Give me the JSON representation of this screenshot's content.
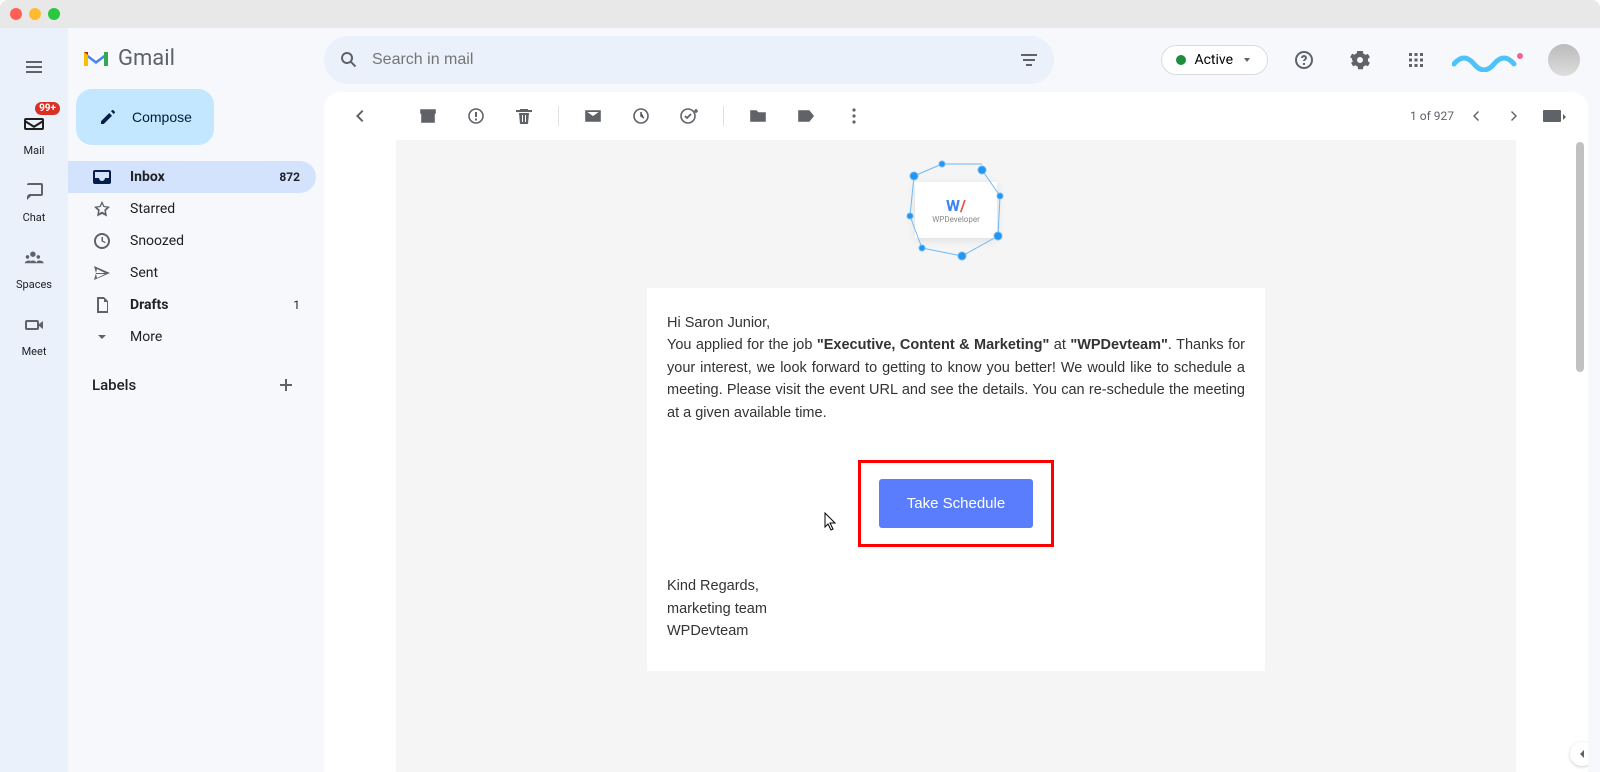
{
  "brand": {
    "name": "Gmail"
  },
  "rail": {
    "mail": {
      "label": "Mail",
      "badge": "99+"
    },
    "chat": {
      "label": "Chat"
    },
    "spaces": {
      "label": "Spaces"
    },
    "meet": {
      "label": "Meet"
    }
  },
  "compose": {
    "label": "Compose"
  },
  "nav": {
    "inbox": {
      "label": "Inbox",
      "count": "872"
    },
    "starred": {
      "label": "Starred"
    },
    "snoozed": {
      "label": "Snoozed"
    },
    "sent": {
      "label": "Sent"
    },
    "drafts": {
      "label": "Drafts",
      "count": "1"
    },
    "more": {
      "label": "More"
    }
  },
  "labels": {
    "heading": "Labels"
  },
  "search": {
    "placeholder": "Search in mail"
  },
  "status": {
    "label": "Active"
  },
  "pager": {
    "text": "1 of 927"
  },
  "email": {
    "greeting": "Hi Saron Junior,",
    "intro_1": "You applied for the job ",
    "job_title": "\"Executive, Content & Marketing\"",
    "intro_2": " at ",
    "company": "\"WPDevteam\"",
    "intro_3": ". Thanks for your interest, we look forward to getting to know you better! We would like to schedule a meeting. Please visit the event URL and see the details. You can re-schedule the meeting at a given available time.",
    "cta": "Take Schedule",
    "signoff_1": "Kind Regards,",
    "signoff_2": "marketing team",
    "signoff_3": "WPDevteam",
    "logo_text": "WPDeveloper"
  }
}
